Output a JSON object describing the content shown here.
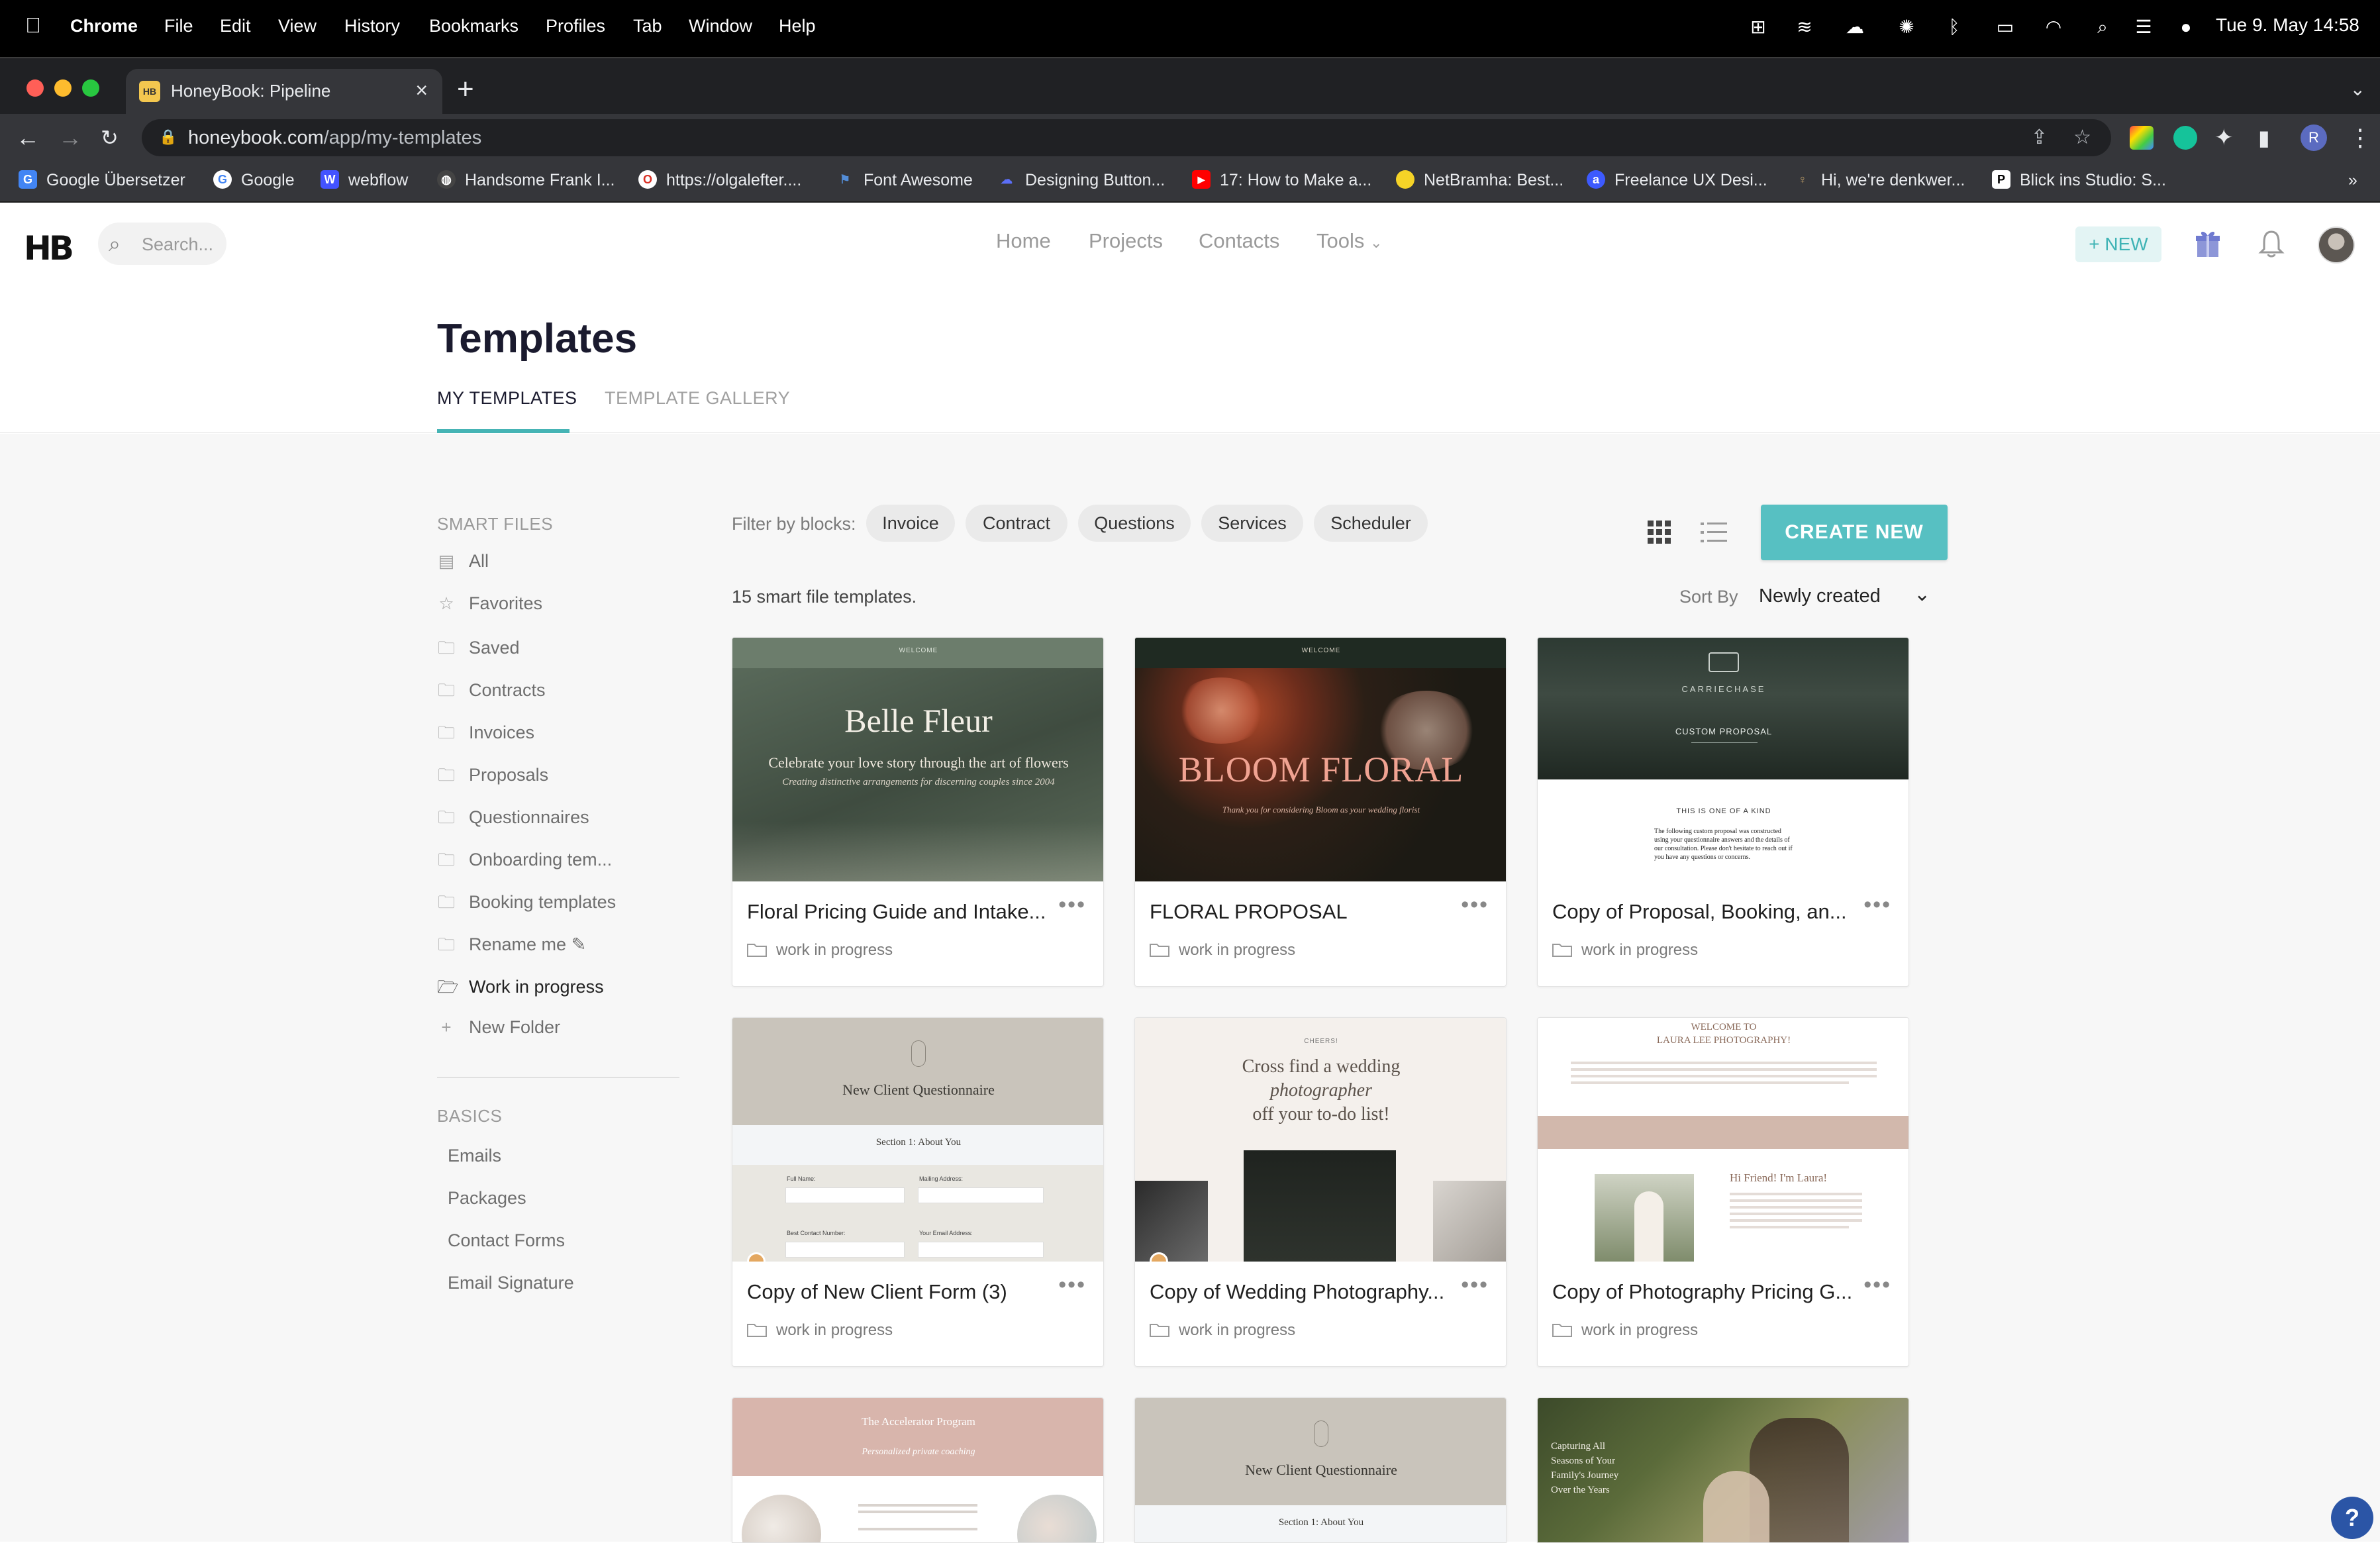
{
  "menubar": {
    "app": "Chrome",
    "items": [
      "File",
      "Edit",
      "View",
      "History",
      "Bookmarks",
      "Profiles",
      "Tab",
      "Window",
      "Help"
    ],
    "datetime": "Tue 9. May  14:58"
  },
  "browser": {
    "tab_title": "HoneyBook: Pipeline",
    "url_domain": "honeybook.com",
    "url_path": "/app/my-templates",
    "bookmarks": [
      {
        "label": "Google Übersetzer",
        "color": "#4285f4"
      },
      {
        "label": "Google",
        "color": "#ffffff"
      },
      {
        "label": "webflow",
        "color": "#4353ff"
      },
      {
        "label": "Handsome Frank I...",
        "color": "#555555"
      },
      {
        "label": "https://olgalefter....",
        "color": "#d93025"
      },
      {
        "label": "Font Awesome",
        "color": "#538dd7"
      },
      {
        "label": "Designing Button...",
        "color": "#5b6ef5"
      },
      {
        "label": "17: How to Make a...",
        "color": "#ff0000"
      },
      {
        "label": "NetBramha: Best...",
        "color": "#f5d327"
      },
      {
        "label": "Freelance UX Desi...",
        "color": "#3d5afe"
      },
      {
        "label": "Hi, we're denkwer...",
        "color": "#7a5c2e"
      },
      {
        "label": "Blick ins Studio: S...",
        "color": "#ffffff"
      }
    ],
    "more": "»"
  },
  "app": {
    "logo": "HB",
    "search_placeholder": "Search...",
    "nav": [
      "Home",
      "Projects",
      "Contacts",
      "Tools"
    ],
    "new_label": "NEW",
    "accent": "#57c0c2"
  },
  "page": {
    "title": "Templates",
    "tabs": [
      "MY TEMPLATES",
      "TEMPLATE GALLERY"
    ],
    "active_tab": "MY TEMPLATES"
  },
  "sidebar": {
    "smart_files_heading": "SMART FILES",
    "smart_files": [
      {
        "label": "All",
        "icon": "grid-icon"
      },
      {
        "label": "Favorites",
        "icon": "star-icon"
      },
      {
        "label": "Saved",
        "icon": "folder-icon"
      },
      {
        "label": "Contracts",
        "icon": "folder-icon"
      },
      {
        "label": "Invoices",
        "icon": "folder-icon"
      },
      {
        "label": "Proposals",
        "icon": "folder-icon"
      },
      {
        "label": "Questionnaires",
        "icon": "folder-icon"
      },
      {
        "label": "Onboarding tem...",
        "icon": "folder-icon"
      },
      {
        "label": "Booking templates",
        "icon": "folder-icon"
      },
      {
        "label": "Rename me ✎",
        "icon": "folder-icon"
      },
      {
        "label": "Work in progress",
        "icon": "folder-open-icon"
      },
      {
        "label": "New Folder",
        "icon": "plus-icon"
      }
    ],
    "basics_heading": "BASICS",
    "basics": [
      "Emails",
      "Packages",
      "Contact Forms",
      "Email Signature"
    ]
  },
  "toolbar": {
    "filter_label": "Filter by blocks:",
    "filters": [
      "Invoice",
      "Contract",
      "Questions",
      "Services",
      "Scheduler"
    ],
    "create_label": "CREATE NEW",
    "count_label": "15 smart file templates.",
    "sort_label": "Sort By",
    "sort_value": "Newly created"
  },
  "cards": [
    {
      "title": "Floral Pricing Guide and Intake...",
      "folder": "work in progress",
      "thumb": {
        "header": "WELCOME",
        "big": "Belle Fleur",
        "line1": "Celebrate your love story through the art of flowers",
        "line2": "Creating distinctive arrangements for discerning couples since 2004"
      }
    },
    {
      "title": "FLORAL PROPOSAL",
      "folder": "work in progress",
      "thumb": {
        "header": "WELCOME",
        "big": "BLOOM FLORAL",
        "line1": "Thank you for considering Bloom as your wedding florist"
      }
    },
    {
      "title": "Copy of Proposal, Booking, an...",
      "folder": "work in progress",
      "thumb": {
        "brand": "CARRIECHASE",
        "sub": "CUSTOM PROPOSAL",
        "head": "THIS IS ONE OF A KIND",
        "body": "The following custom proposal was constructed using your questionnaire answers and the details of our consultation. Please don't hesitate to reach out if you have any questions or concerns."
      }
    },
    {
      "title": "Copy of New Client Form (3)",
      "folder": "work in progress",
      "thumb": {
        "big": "New Client Questionnaire",
        "section": "Section 1: About You",
        "f1": "Full Name:",
        "f2": "Mailing Address:",
        "f3": "Best Contact Number:",
        "f4": "Your Email Address:"
      }
    },
    {
      "title": "Copy of Wedding Photography...",
      "folder": "work in progress",
      "thumb": {
        "small": "CHEERS!",
        "line1": "Cross find a wedding",
        "line2": "photographer",
        "line3": "off your to-do list!"
      }
    },
    {
      "title": "Copy of Photography Pricing G...",
      "folder": "work in progress",
      "thumb": {
        "head": "WELCOME TO",
        "head2": "LAURA LEE PHOTOGRAPHY!",
        "hi": "Hi Friend! I'm Laura!"
      }
    },
    {
      "thumb": {
        "head": "The Accelerator Program",
        "sub": "Personalized private coaching"
      }
    },
    {
      "thumb": {
        "big": "New Client Questionnaire",
        "section": "Section 1: About You"
      }
    },
    {
      "thumb": {
        "line1": "Capturing All",
        "line2": "Seasons of Your",
        "line3": "Family's Journey",
        "line4": "Over the Years"
      }
    }
  ],
  "help_label": "?"
}
